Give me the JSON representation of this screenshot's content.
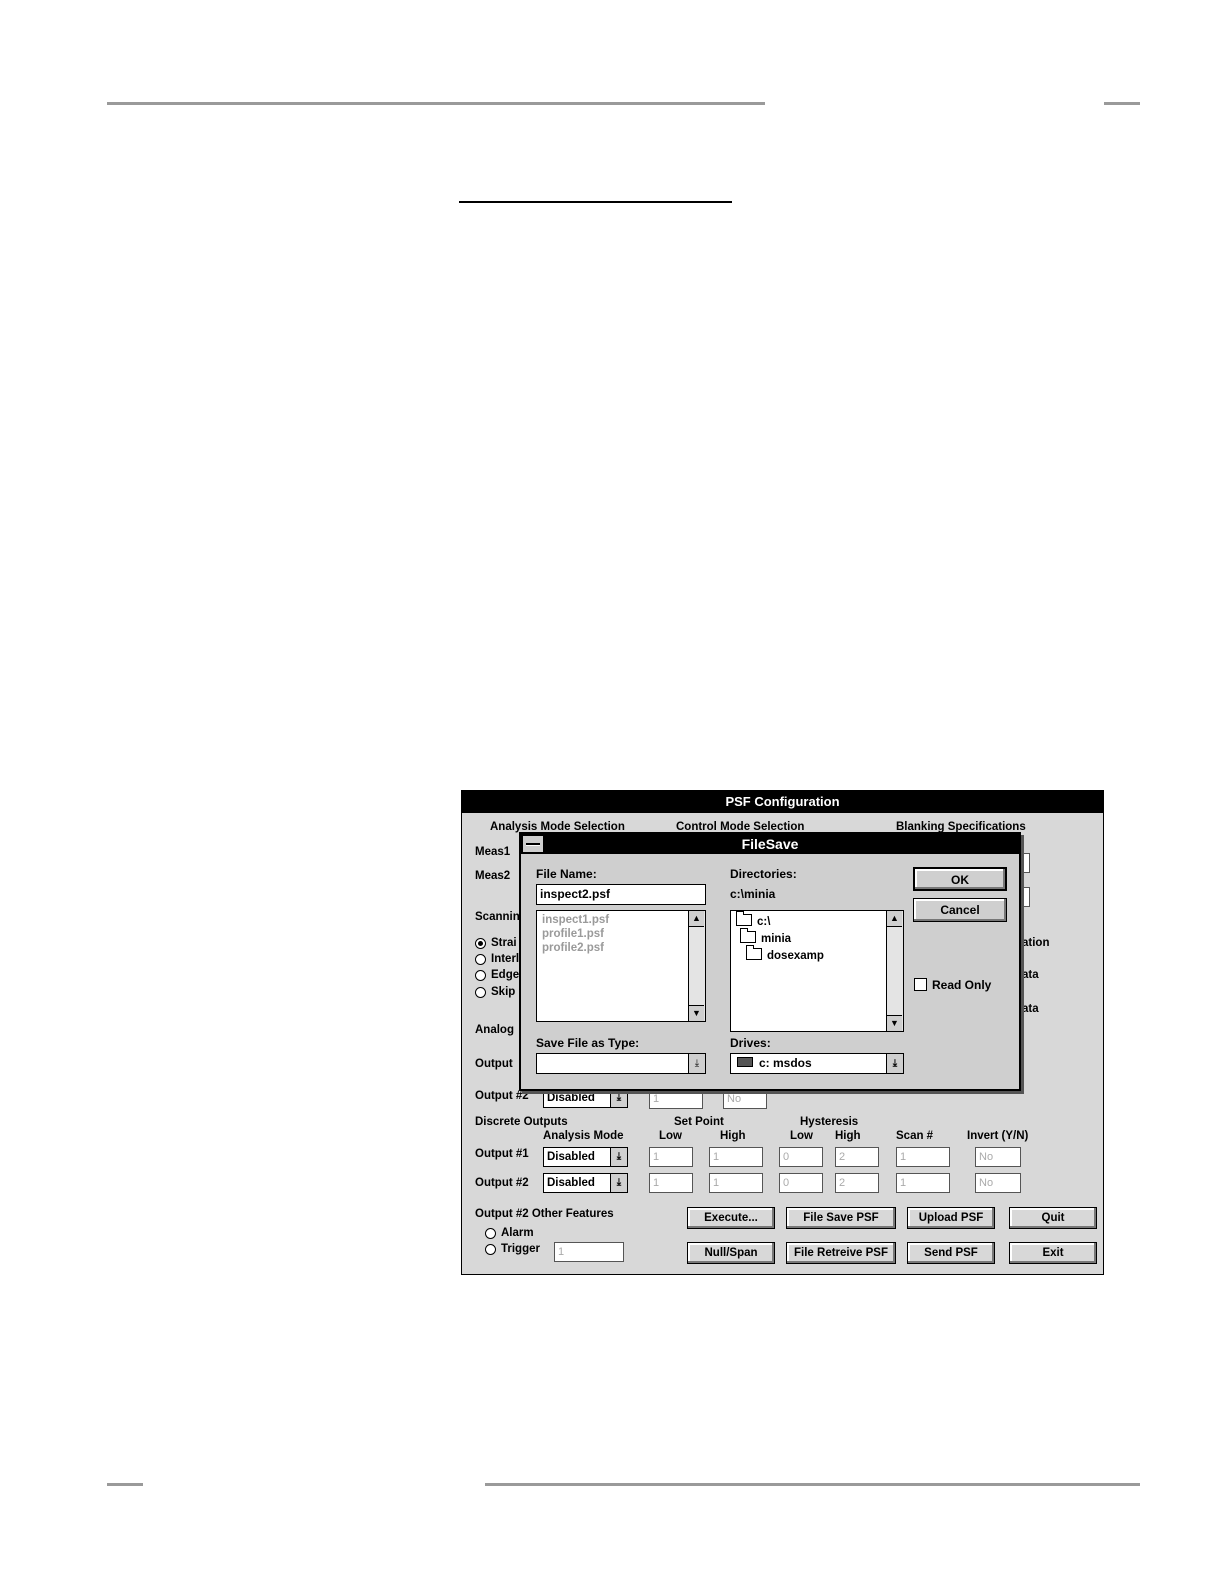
{
  "psf": {
    "title": "PSF Configuration",
    "headers": {
      "analysis": "Analysis Mode Selection",
      "control": "Control Mode Selection",
      "blanking": "Blanking Specifications"
    },
    "meas1": "Meas1",
    "meas2": "Meas2",
    "scanning": "Scannin",
    "scan_options": [
      {
        "label": "Strai",
        "selected": true
      },
      {
        "label": "Interl",
        "selected": false
      },
      {
        "label": "Edge",
        "selected": false
      },
      {
        "label": "Skip",
        "selected": false
      }
    ],
    "right_fragments": [
      "ation",
      "ata",
      "ata"
    ],
    "analog": "Analog",
    "output1_short": "Output",
    "output2_label": "Output #2",
    "analog_output2": {
      "mode": "Disabled",
      "v1": "1",
      "v2": "No"
    },
    "discrete": {
      "title": "Discrete Outputs",
      "col_analysis": "Analysis Mode",
      "set_point": "Set Point",
      "hysteresis": "Hysteresis",
      "low": "Low",
      "high": "High",
      "scan": "Scan #",
      "invert": "Invert (Y/N)",
      "rows": [
        {
          "label": "Output #1",
          "mode": "Disabled",
          "sp_low": "1",
          "sp_high": "1",
          "hy_low": "0",
          "hy_high": "2",
          "scan": "1",
          "invert": "No"
        },
        {
          "label": "Output #2",
          "mode": "Disabled",
          "sp_low": "1",
          "sp_high": "1",
          "hy_low": "0",
          "hy_high": "2",
          "scan": "1",
          "invert": "No"
        }
      ]
    },
    "other": {
      "title": "Output #2 Other Features",
      "alarm": "Alarm",
      "trigger": "Trigger",
      "trigger_value": "1"
    },
    "buttons": {
      "execute": "Execute...",
      "file_save": "File Save PSF",
      "upload": "Upload PSF",
      "quit": "Quit",
      "null_span": "Null/Span",
      "file_retrieve": "File Retreive PSF",
      "send": "Send PSF",
      "exit": "Exit"
    }
  },
  "filesave": {
    "title": "FileSave",
    "file_name_label": "File Name:",
    "file_name_value": "inspect2.psf",
    "files": [
      "inspect1.psf",
      "profile1.psf",
      "profile2.psf"
    ],
    "directories_label": "Directories:",
    "current_dir": "c:\\minia",
    "dirs": [
      "c:\\",
      "minia",
      "dosexamp"
    ],
    "type_label": "Save File as Type:",
    "drives_label": "Drives:",
    "drive_value": "c: msdos",
    "ok": "OK",
    "cancel": "Cancel",
    "read_only": "Read Only"
  }
}
